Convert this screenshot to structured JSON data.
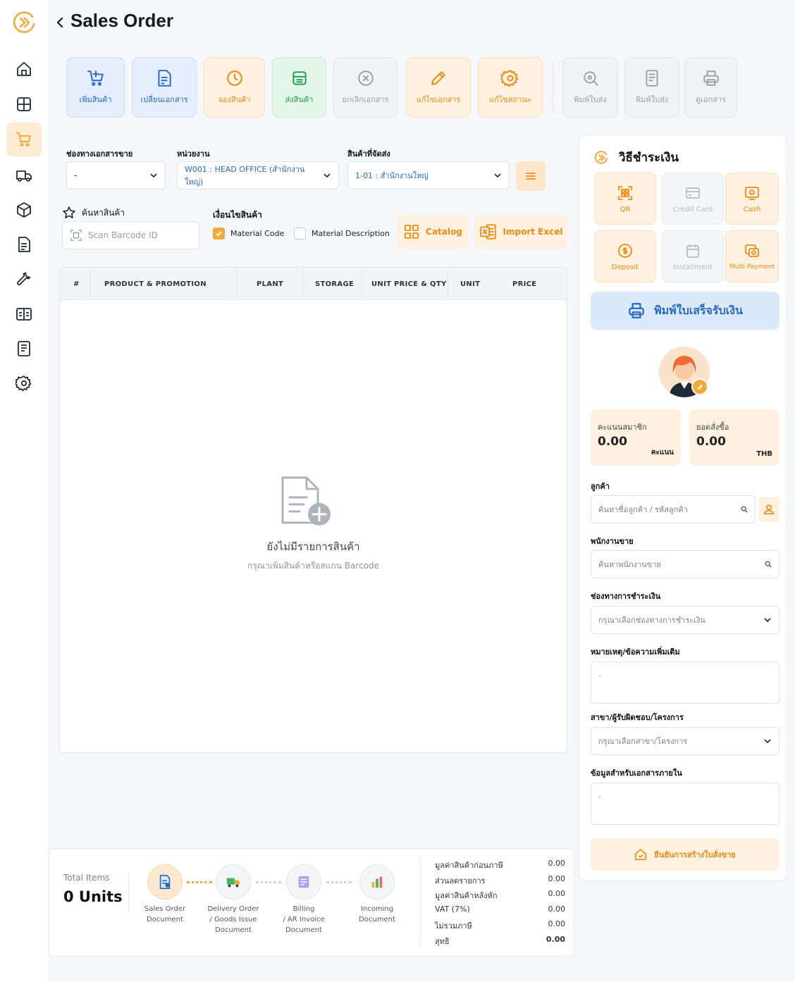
{
  "header": {
    "title": "Sales Order"
  },
  "colors": {
    "accent": "#F6A93B",
    "blue": "#2668C4",
    "green": "#1E9E4B",
    "gray": "#9AA0A8"
  },
  "sidebar": {
    "items": [
      {
        "icon": "home-icon"
      },
      {
        "icon": "grid-icon"
      },
      {
        "icon": "cart-icon"
      },
      {
        "icon": "truck-icon"
      },
      {
        "icon": "box-icon"
      },
      {
        "icon": "document-icon"
      },
      {
        "icon": "wrench-icon"
      },
      {
        "icon": "book-icon"
      },
      {
        "icon": "report-icon"
      },
      {
        "icon": "gear-icon"
      }
    ]
  },
  "toolbar": {
    "add_product": "เพิ่มสินค้า",
    "change_doc": "เปลี่ยนเอกสาร",
    "reserve": "จองสินค้า",
    "ship": "ส่งสินค้า",
    "cancel_doc": "ยกเลิกเอกสาร",
    "edit_doc": "แก้ไขเอกสาร",
    "edit_status": "แก้ไขสถานะ",
    "print_ship_1": "พิมพ์ใบส่ง",
    "print_ship_2": "พิมพ์ใบส่ง",
    "view_doc": "ดูเอกสาร"
  },
  "form": {
    "channel_label": "ช่องทางเอกสารขาย",
    "channel_value": "-",
    "unit_label": "หน่วยงาน",
    "unit_value": "W001 : HEAD OFFICE (สำนักงานใหญ่)",
    "ship_label": "สินค้าที่จัดส่ง",
    "ship_value": "1-01 : สำนักงานใหญ่",
    "search_label": "ค้นหาสินค้า",
    "search_placeholder": "Scan Barcode ID",
    "condition_label": "เงื่อนไขสินค้า",
    "material_code": "Material Code",
    "material_code_checked": true,
    "material_desc": "Material Description",
    "material_desc_checked": false,
    "catalog": "Catalog",
    "import_excel": "Import Excel"
  },
  "table": {
    "columns": [
      "#",
      "PRODUCT & PROMOTION",
      "PLANT",
      "STORAGE",
      "UNIT PRICE & QTY",
      "UNIT",
      "PRICE"
    ],
    "empty_title": "ยังไม่มีรายการสินค้า",
    "empty_subtitle": "กรุณาเพิ่มสินค้าหรือสแกน Barcode"
  },
  "bottom": {
    "total_label": "Total Items",
    "total_value": "0 Units",
    "steps": [
      {
        "line1": "Sales Order",
        "line2": "Document",
        "line3": ""
      },
      {
        "line1": "Delivery Order",
        "line2": "/ Goods Issue",
        "line3": "Document"
      },
      {
        "line1": "Billing",
        "line2": "/ AR Invoice",
        "line3": "Document"
      },
      {
        "line1": "Incoming",
        "line2": "Document",
        "line3": ""
      }
    ],
    "summary": [
      {
        "label": "มูลค่าสินค้าก่อนภาษี",
        "value": "0.00"
      },
      {
        "label": "ส่วนลดรายการ",
        "value": "0.00"
      },
      {
        "label": "มูลค่าสินค้าหลังหัก",
        "value": "0.00"
      },
      {
        "label": "VAT (7%)",
        "value": "0.00"
      },
      {
        "label": "ไม่รวมภาษี",
        "value": "0.00"
      },
      {
        "label": "สุทธิ",
        "value": "0.00"
      }
    ]
  },
  "panel": {
    "title": "วิธีชำระเงิน",
    "methods": [
      {
        "label": "QR",
        "enabled": true
      },
      {
        "label": "Credit Card",
        "enabled": false
      },
      {
        "label": "Cash",
        "enabled": true
      },
      {
        "label": "Deposit",
        "enabled": true
      },
      {
        "label": "Installment",
        "enabled": false
      },
      {
        "label": "Multi Payment",
        "enabled": true
      }
    ],
    "print_receipt": "พิมพ์ใบเสร็จรับเงิน",
    "member_points_label": "คะแนนสมาชิก",
    "member_points_value": "0.00",
    "member_points_unit": "คะแนน",
    "order_total_label": "ยอดสั่งซื้อ",
    "order_total_value": "0.00",
    "order_total_unit": "THB",
    "customer_label": "ลูกค้า",
    "customer_placeholder": "ค้นหาชื่อลูกค้า / รหัสลูกค้า",
    "sales_label": "พนักงานขาย",
    "sales_placeholder": "ค้นหาพนักงานขาย",
    "pay_channel_label": "ช่องทางการชำระเงิน",
    "pay_channel_placeholder": "กรุณาเลือกช่องทางการชำระเงิน",
    "note_label": "หมายเหตุ/ข้อความเพิ่มเติม",
    "note_value": "-",
    "branch_label": "สาขา/ผู้รับผิดชอบ/โครงการ",
    "branch_placeholder": "กรุณาเลือกสาขา/โครงการ",
    "internal_label": "ข้อมูลสำหรับเอกสารภายใน",
    "internal_value": "-",
    "confirm": "ยืนยันการสร้างใบสั่งขาย"
  }
}
